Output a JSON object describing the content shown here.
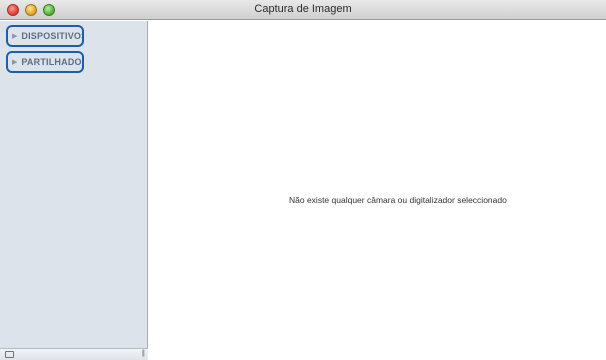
{
  "window": {
    "title": "Captura de Imagem"
  },
  "sidebar": {
    "sections": [
      {
        "label": "DISPOSITIVOS"
      },
      {
        "label": "PARTILHADO"
      }
    ]
  },
  "main": {
    "empty_message": "Não existe qualquer câmara ou digitalizador seleccionado"
  },
  "colors": {
    "sidebar_bg": "#dde3ea",
    "highlight_border": "#1c5ea8"
  },
  "icons": {
    "sidebar_bottom_left": "toggle-panel-icon",
    "sidebar_bottom_right": "resize-grip-icon"
  }
}
